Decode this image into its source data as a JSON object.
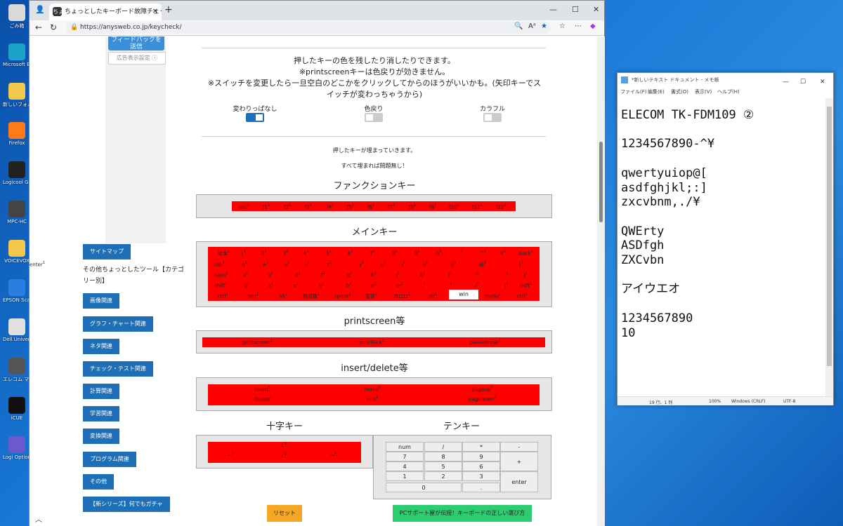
{
  "desktop": {
    "icons": [
      "ごみ箱",
      "Microsoft Edge",
      "新しいフォルダー",
      "Firefox",
      "Logicool G HUB",
      "MPC-HC",
      "VOICEVOX",
      "EPSON Scan",
      "Dell Universal Receiver Control",
      "エレコム マウスアシスタント",
      "iCUE",
      "Logi Options+"
    ]
  },
  "browser": {
    "tab_title": "ちょっとしたキーボード故障チェック・テスト",
    "tab_favicon": "ちょ",
    "url": "https://anysweb.co.jp/keycheck/"
  },
  "sidebar": {
    "top_button": "フィードバックを送信",
    "ad_settings": "広告表示設定 ⓘ",
    "sitemap": "サイトマップ",
    "other_tools_label": "その他ちょっとしたツール【カテゴリー別】",
    "categories": [
      "画像関連",
      "グラフ・チャート関連",
      "ネタ関連",
      "チェック・テスト関連",
      "計算関連",
      "学習関連",
      "変換関連",
      "プログラム関連",
      "その他",
      "【新シリーズ】何でもガチャ"
    ]
  },
  "intro": {
    "line1": "押したキーの色を残したり消したりできます。",
    "line2": "※printscreenキーは色戻りが効きません。",
    "line3": "※スイッチを変更したら一旦空白のどこかをクリックしてからのほうがいいかも。(矢印キーでス",
    "line4": "イッチが変わっちゃうから)"
  },
  "toggles": [
    {
      "label": "変わりっぱなし",
      "on": true
    },
    {
      "label": "色戻り",
      "on": false
    },
    {
      "label": "カラフル",
      "on": false
    }
  ],
  "info": {
    "line1": "押したキーが埋まっていきます。",
    "line2": "すべて埋まれば問題無し！"
  },
  "sections": {
    "function": "ファンクションキー",
    "main": "メインキー",
    "printscreen": "printscreen等",
    "insert": "insert/delete等",
    "arrow": "十字キー",
    "numpad": "テンキー"
  },
  "function_keys": [
    "esc",
    "f1",
    "f2",
    "f3",
    "f4",
    "f5",
    "f6",
    "f7",
    "f8",
    "f9",
    "f10",
    "f11",
    "f12"
  ],
  "main_rows": [
    [
      "半全",
      "1",
      "2",
      "3",
      "4",
      "5",
      "6",
      "7",
      "8",
      "9",
      "0",
      "-",
      "^",
      "¥",
      "back"
    ],
    [
      "tab",
      "q",
      "w",
      "e",
      "r",
      "t",
      "y",
      "u",
      "i",
      "o",
      "p",
      "@",
      "[",
      "enter"
    ],
    [
      "caps",
      "a",
      "s",
      "d",
      "f",
      "g",
      "h",
      "j",
      "k",
      "l",
      ";",
      ":",
      "]"
    ],
    [
      "shift",
      "z",
      "x",
      "c",
      "v",
      "b",
      "n",
      "m",
      ",",
      ".",
      "/",
      "\\",
      "shift"
    ],
    [
      "ctrl",
      "win",
      "alt",
      "無変換",
      "space",
      "変換",
      "カロロ",
      "alt",
      "win",
      "menu",
      "ctrl"
    ]
  ],
  "print_keys": [
    "printscreen",
    "scrolllock",
    "pausebreak"
  ],
  "insert_keys": {
    "row1": [
      "insert",
      "home",
      "pageup"
    ],
    "row2": [
      "delete",
      "end",
      "pagedown"
    ]
  },
  "arrow_keys": [
    "↑",
    "←",
    "↓",
    "→"
  ],
  "numpad": [
    [
      "num",
      "/",
      "*",
      "-"
    ],
    [
      "7",
      "8",
      "9",
      "+"
    ],
    [
      "4",
      "5",
      "6"
    ],
    [
      "1",
      "2",
      "3",
      "enter"
    ],
    [
      "0",
      "."
    ]
  ],
  "buttons": {
    "reset": "リセット",
    "guide": "PCサポート屋が伝授！キーボードの正しい選び方"
  },
  "notepad": {
    "title": "*新しいテキスト ドキュメント - メモ帳",
    "menu": [
      "ファイル(F)",
      "編集(E)",
      "書式(O)",
      "表示(V)",
      "ヘルプ(H)"
    ],
    "lines": [
      "ELECOM TK-FDM109 ②",
      "",
      "1234567890-^¥",
      "",
      "qwertyuiop@[",
      "asdfghjkl;:]",
      "zxcvbnm,./¥",
      "",
      "QWErty",
      "ASDfgh",
      "ZXCvbn",
      "",
      "アイウエオ",
      "",
      "1234567890",
      "10"
    ],
    "status": {
      "position": "19 行、1 列",
      "zoom": "100%",
      "eol": "Windows (CRLF)",
      "encoding": "UTF-8"
    }
  }
}
